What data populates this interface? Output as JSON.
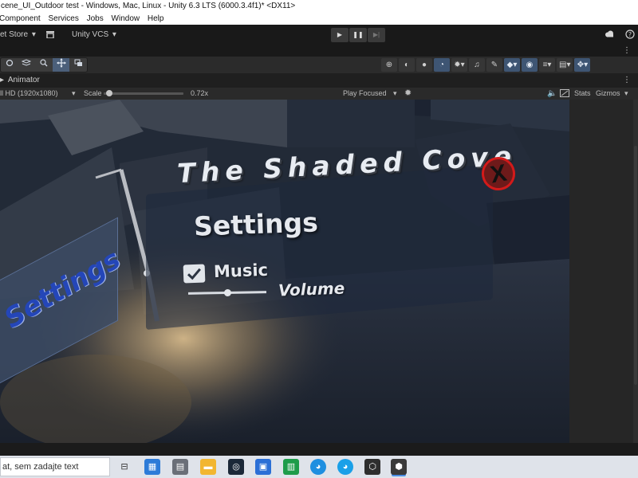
{
  "window": {
    "title": "cene_UI_Outdoor test - Windows, Mac, Linux - Unity 6.3 LTS (6000.3.4f1)* <DX11>"
  },
  "menu": {
    "items": [
      "Component",
      "Services",
      "Jobs",
      "Window",
      "Help"
    ]
  },
  "toolbar": {
    "asset_store": "et Store",
    "vcs": "Unity VCS",
    "dropdown_glyph": "▾",
    "play_glyph": "▶",
    "pause_glyph": "❚❚",
    "step_glyph": "▶|",
    "more_glyph": "⋮"
  },
  "tab": {
    "label": "Animator",
    "arrow": "▸"
  },
  "game_view": {
    "resolution": "ll HD (1920x1080)",
    "scale_label": "Scale",
    "scale_value": "0.72x",
    "scale_level": 0.05,
    "play_mode": "Play Focused",
    "stats": "Stats",
    "gizmos": "Gizmos"
  },
  "scene": {
    "title": "The Shaded Cove",
    "settings_heading": "Settings",
    "music_label": "Music",
    "volume_label": "Volume",
    "music_checked": true,
    "volume_level": 0.5,
    "side_sign": "Settings",
    "close_glyph": "X"
  },
  "taskbar": {
    "search_text": "at, sem zadajte text"
  },
  "colors": {
    "accent_blue": "#3e5573",
    "close_red": "#d31a1a",
    "sign_blue": "#2446b8"
  }
}
